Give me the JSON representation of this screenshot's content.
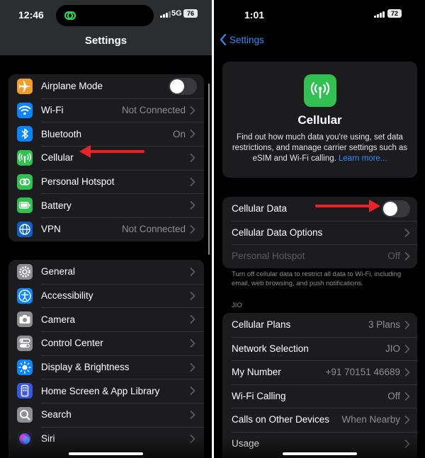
{
  "left": {
    "status": {
      "time": "12:46",
      "network": "5G",
      "battery": "76"
    },
    "title": "Settings",
    "group1": [
      {
        "label": "Airplane Mode",
        "value": "",
        "icon": "airplane-icon",
        "color": "#f39c2a",
        "control": "toggle"
      },
      {
        "label": "Wi-Fi",
        "value": "Not Connected",
        "icon": "wifi-icon",
        "color": "#0a84ff",
        "control": "chevron"
      },
      {
        "label": "Bluetooth",
        "value": "On",
        "icon": "bluetooth-icon",
        "color": "#0a84ff",
        "control": "chevron"
      },
      {
        "label": "Cellular",
        "value": "",
        "icon": "antenna-icon",
        "color": "#30c150",
        "control": "chevron"
      },
      {
        "label": "Personal Hotspot",
        "value": "",
        "icon": "hotspot-link-icon",
        "color": "#30c150",
        "control": "chevron"
      },
      {
        "label": "Battery",
        "value": "",
        "icon": "battery-icon",
        "color": "#30c150",
        "control": "chevron"
      },
      {
        "label": "VPN",
        "value": "Not Connected",
        "icon": "globe-icon",
        "color": "#0a60c8",
        "control": "chevron"
      }
    ],
    "group2": [
      {
        "label": "General",
        "icon": "gear-icon",
        "color": "#8e8e93"
      },
      {
        "label": "Accessibility",
        "icon": "accessibility-icon",
        "color": "#0a84ff"
      },
      {
        "label": "Camera",
        "icon": "camera-icon",
        "color": "#8e8e93"
      },
      {
        "label": "Control Center",
        "icon": "switches-icon",
        "color": "#8e8e93"
      },
      {
        "label": "Display & Brightness",
        "icon": "sun-icon",
        "color": "#0a84ff"
      },
      {
        "label": "Home Screen & App Library",
        "icon": "home-screen-icon",
        "color": "#3a58e0"
      },
      {
        "label": "Search",
        "icon": "search-icon",
        "color": "#8e8e93"
      },
      {
        "label": "Siri",
        "icon": "siri-icon",
        "color": "#222222"
      }
    ]
  },
  "right": {
    "status": {
      "time": "1:01",
      "battery": "72"
    },
    "back_label": "Settings",
    "card": {
      "title": "Cellular",
      "description": "Find out how much data you're using, set data restrictions, and manage carrier settings such as eSIM and Wi-Fi calling.",
      "link": "Learn more..."
    },
    "group1": [
      {
        "label": "Cellular Data",
        "value": "",
        "control": "toggle",
        "dim": false
      },
      {
        "label": "Cellular Data Options",
        "value": "",
        "control": "chevron",
        "dim": false
      },
      {
        "label": "Personal Hotspot",
        "value": "Off",
        "control": "chevron",
        "dim": true
      }
    ],
    "footnote": "Turn off cellular data to restrict all data to Wi-Fi, including email, web browsing, and push notifications.",
    "section_header": "JIO",
    "group2": [
      {
        "label": "Cellular Plans",
        "value": "3 Plans"
      },
      {
        "label": "Network Selection",
        "value": "JIO"
      },
      {
        "label": "My Number",
        "value": "+91 70151 46689"
      },
      {
        "label": "Wi-Fi Calling",
        "value": "Off"
      },
      {
        "label": "Calls on Other Devices",
        "value": "When Nearby"
      },
      {
        "label": "Usage",
        "value": ""
      }
    ]
  },
  "colors": {
    "accent_blue": "#2f8bff",
    "annotation_red": "#e8232a",
    "cell_green": "#30c150"
  }
}
